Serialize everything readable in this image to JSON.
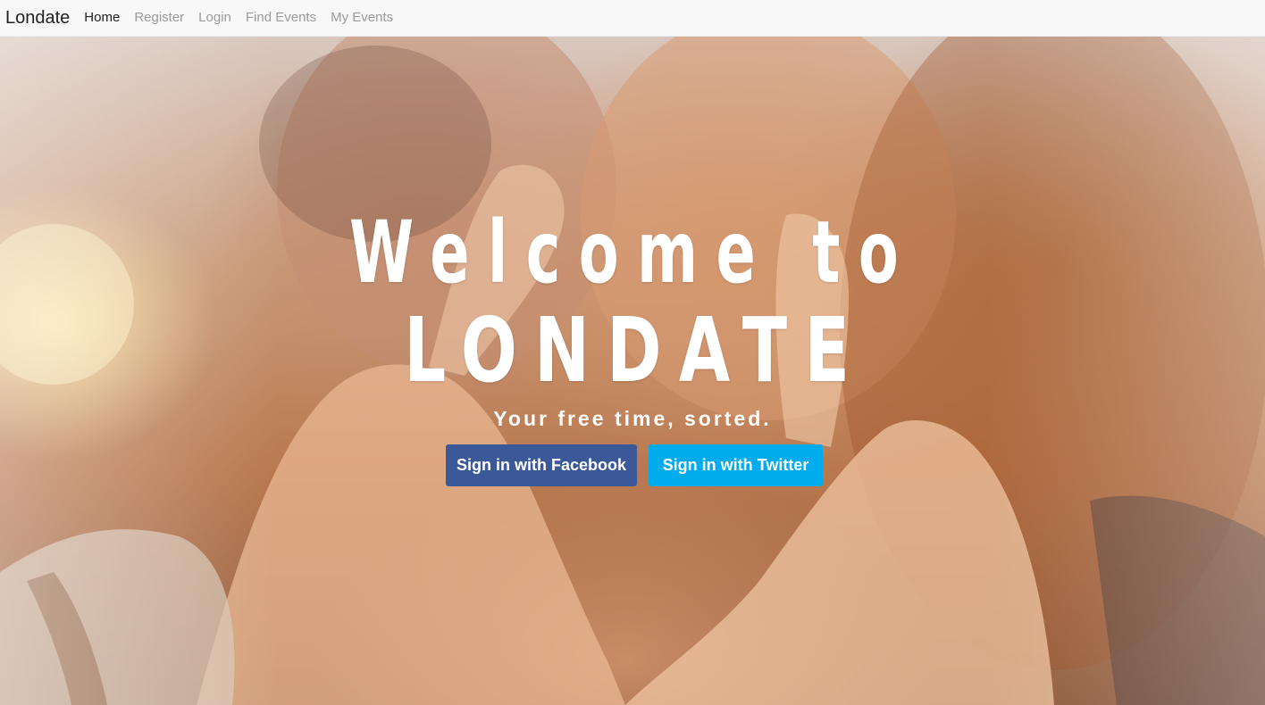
{
  "navbar": {
    "brand": "Londate",
    "links": [
      {
        "label": "Home",
        "active": true
      },
      {
        "label": "Register",
        "active": false
      },
      {
        "label": "Login",
        "active": false
      },
      {
        "label": "Find Events",
        "active": false
      },
      {
        "label": "My Events",
        "active": false
      }
    ]
  },
  "hero": {
    "headline_line1": "Welcome to",
    "headline_line2": "LONDATE",
    "tagline": "Your free time, sorted.",
    "facebook_button": "Sign in with Facebook",
    "twitter_button": "Sign in with Twitter"
  },
  "colors": {
    "facebook": "#3b5998",
    "twitter": "#00aced",
    "navbar_bg": "#f8f8f9"
  }
}
